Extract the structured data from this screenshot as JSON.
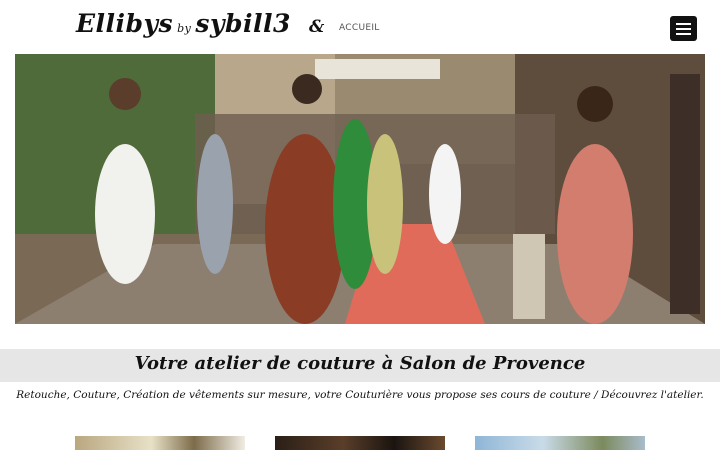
{
  "header": {
    "logo_main": "Ellibys",
    "logo_by": "by",
    "logo_second": "sybill3",
    "monogram": "&",
    "nav_home": "ACCUEIL"
  },
  "hero": {
    "description_icon": "photo-fashion-show"
  },
  "banner": {
    "title": "Votre atelier de couture à Salon de Provence"
  },
  "tagline": "Retouche, Couture, Création de vêtements sur mesure, votre Couturière vous propose ses cours de couture / Découvrez l'atelier.",
  "colors": {
    "banner_bg": "#e6e6e6",
    "menu_button": "#111111"
  }
}
